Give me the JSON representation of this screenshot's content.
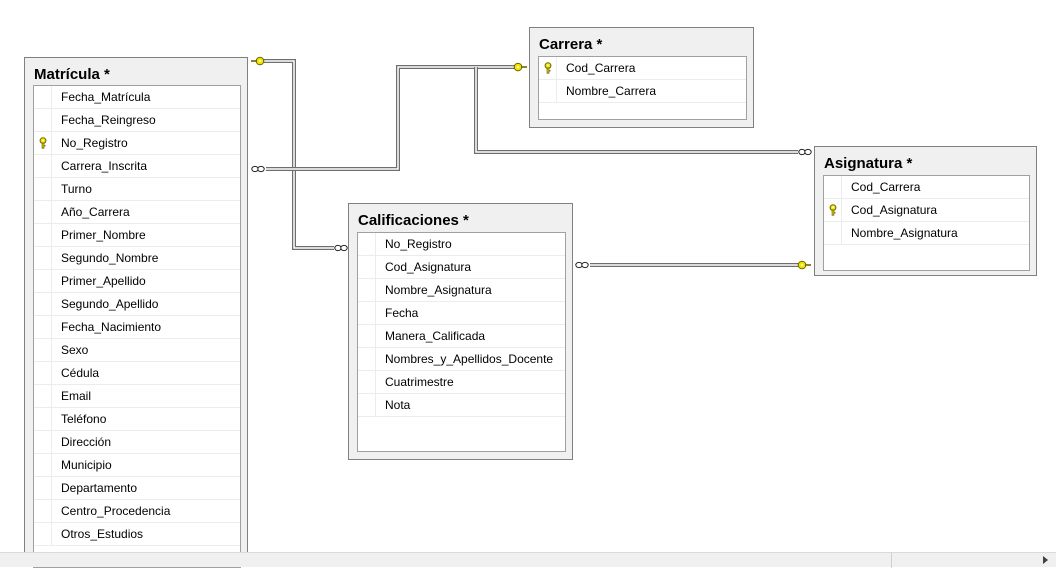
{
  "diagram": {
    "tables": [
      {
        "id": "matricula",
        "title": "Matrícula *",
        "columns": [
          {
            "name": "Fecha_Matrícula",
            "key": false
          },
          {
            "name": "Fecha_Reingreso",
            "key": false
          },
          {
            "name": "No_Registro",
            "key": true
          },
          {
            "name": "Carrera_Inscrita",
            "key": false
          },
          {
            "name": "Turno",
            "key": false
          },
          {
            "name": "Año_Carrera",
            "key": false
          },
          {
            "name": "Primer_Nombre",
            "key": false
          },
          {
            "name": "Segundo_Nombre",
            "key": false
          },
          {
            "name": "Primer_Apellido",
            "key": false
          },
          {
            "name": "Segundo_Apellido",
            "key": false
          },
          {
            "name": "Fecha_Nacimiento",
            "key": false
          },
          {
            "name": "Sexo",
            "key": false
          },
          {
            "name": "Cédula",
            "key": false
          },
          {
            "name": "Email",
            "key": false
          },
          {
            "name": "Teléfono",
            "key": false
          },
          {
            "name": "Dirección",
            "key": false
          },
          {
            "name": "Municipio",
            "key": false
          },
          {
            "name": "Departamento",
            "key": false
          },
          {
            "name": "Centro_Procedencia",
            "key": false
          },
          {
            "name": "Otros_Estudios",
            "key": false
          }
        ]
      },
      {
        "id": "carrera",
        "title": "Carrera *",
        "columns": [
          {
            "name": "Cod_Carrera",
            "key": true
          },
          {
            "name": "Nombre_Carrera",
            "key": false
          }
        ]
      },
      {
        "id": "calificaciones",
        "title": "Calificaciones *",
        "columns": [
          {
            "name": "No_Registro",
            "key": false
          },
          {
            "name": "Cod_Asignatura",
            "key": false
          },
          {
            "name": "Nombre_Asignatura",
            "key": false
          },
          {
            "name": "Fecha",
            "key": false
          },
          {
            "name": "Manera_Calificada",
            "key": false
          },
          {
            "name": "Nombres_y_Apellidos_Docente",
            "key": false
          },
          {
            "name": "Cuatrimestre",
            "key": false
          },
          {
            "name": "Nota",
            "key": false
          }
        ]
      },
      {
        "id": "asignatura",
        "title": "Asignatura *",
        "columns": [
          {
            "name": "Cod_Carrera",
            "key": false
          },
          {
            "name": "Cod_Asignatura",
            "key": true
          },
          {
            "name": "Nombre_Asignatura",
            "key": false
          }
        ]
      }
    ],
    "relationships": [
      {
        "one": "matricula",
        "many": "calificaciones"
      },
      {
        "one": "carrera",
        "many": "matricula"
      },
      {
        "one": "carrera",
        "many": "asignatura"
      },
      {
        "one": "asignatura",
        "many": "calificaciones"
      }
    ]
  },
  "icons": {
    "key": "primary-key-icon",
    "one_end": "key-endpoint-icon",
    "many_end": "infinity-endpoint-icon"
  },
  "colors": {
    "key_fill": "#f2e600",
    "key_stroke": "#6b6400",
    "line": "#6e6e6e",
    "canvas": "#ffffff",
    "table_bg": "#f0f0f0"
  }
}
